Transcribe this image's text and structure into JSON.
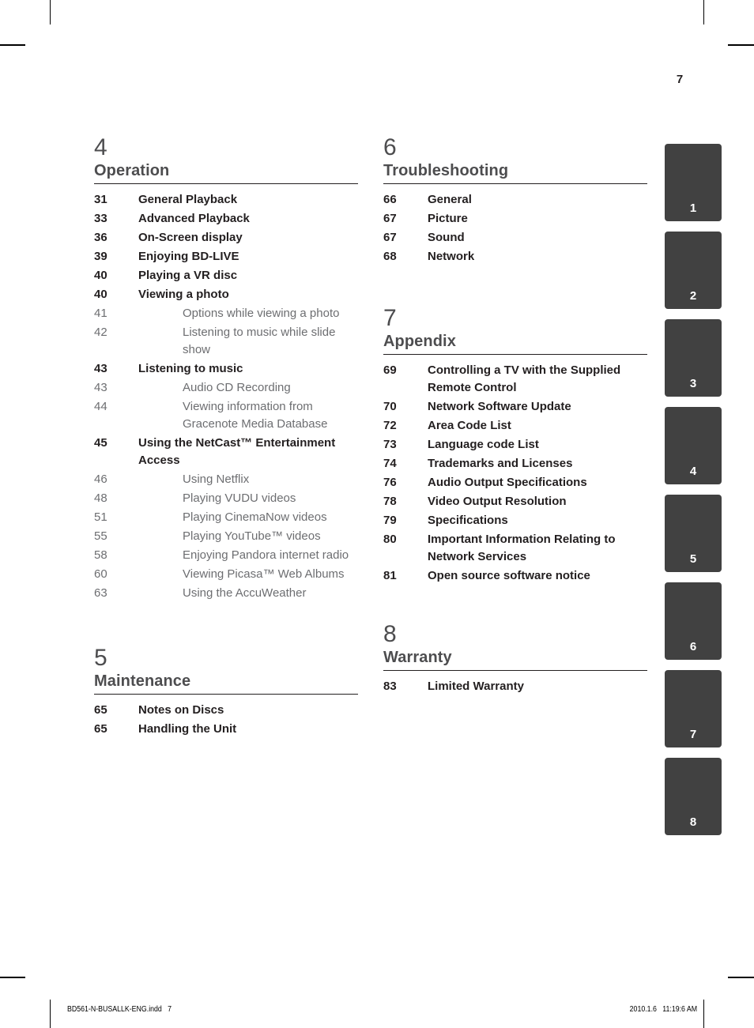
{
  "page": {
    "number": "7",
    "colors": {
      "heading": "#4d4d4f",
      "level1_text": "#231f20",
      "level2_text": "#6d6e71",
      "tab_background": "#414141",
      "tab_text": "#ffffff",
      "rule": "#231f20"
    }
  },
  "columns": {
    "left": [
      {
        "number": "4",
        "title": "Operation",
        "entries": [
          {
            "page": "31",
            "label": "General Playback",
            "level": 1
          },
          {
            "page": "33",
            "label": "Advanced Playback",
            "level": 1
          },
          {
            "page": "36",
            "label": "On-Screen display",
            "level": 1
          },
          {
            "page": "39",
            "label": "Enjoying BD-LIVE",
            "level": 1
          },
          {
            "page": "40",
            "label": "Playing a VR disc",
            "level": 1
          },
          {
            "page": "40",
            "label": "Viewing a photo",
            "level": 1
          },
          {
            "page": "41",
            "label": "Options while viewing a photo",
            "level": 2
          },
          {
            "page": "42",
            "label": "Listening to music while slide show",
            "level": 2
          },
          {
            "page": "43",
            "label": "Listening to music",
            "level": 1
          },
          {
            "page": "43",
            "label": "Audio CD Recording",
            "level": 2
          },
          {
            "page": "44",
            "label": "Viewing information from Gracenote Media Database",
            "level": 2
          },
          {
            "page": "45",
            "label": "Using the NetCast™ Entertainment Access",
            "level": 1
          },
          {
            "page": "46",
            "label": "Using Netflix",
            "level": 2
          },
          {
            "page": "48",
            "label": "Playing VUDU videos",
            "level": 2
          },
          {
            "page": "51",
            "label": "Playing CinemaNow videos",
            "level": 2
          },
          {
            "page": "55",
            "label": "Playing YouTube™ videos",
            "level": 2
          },
          {
            "page": "58",
            "label": "Enjoying Pandora internet radio",
            "level": 2
          },
          {
            "page": "60",
            "label": "Viewing Picasa™ Web Albums",
            "level": 2
          },
          {
            "page": "63",
            "label": "Using the AccuWeather",
            "level": 2
          }
        ]
      },
      {
        "number": "5",
        "title": "Maintenance",
        "entries": [
          {
            "page": "65",
            "label": "Notes on Discs",
            "level": 1
          },
          {
            "page": "65",
            "label": "Handling the Unit",
            "level": 1
          }
        ]
      }
    ],
    "right": [
      {
        "number": "6",
        "title": "Troubleshooting",
        "entries": [
          {
            "page": "66",
            "label": "General",
            "level": 1
          },
          {
            "page": "67",
            "label": "Picture",
            "level": 1
          },
          {
            "page": "67",
            "label": "Sound",
            "level": 1
          },
          {
            "page": "68",
            "label": "Network",
            "level": 1
          }
        ]
      },
      {
        "number": "7",
        "title": "Appendix",
        "entries": [
          {
            "page": "69",
            "label": "Controlling a TV with the Supplied Remote Control",
            "level": 1
          },
          {
            "page": "70",
            "label": "Network Software Update",
            "level": 1
          },
          {
            "page": "72",
            "label": "Area Code List",
            "level": 1
          },
          {
            "page": "73",
            "label": "Language code List",
            "level": 1
          },
          {
            "page": "74",
            "label": "Trademarks and Licenses",
            "level": 1
          },
          {
            "page": "76",
            "label": "Audio Output Specifications",
            "level": 1
          },
          {
            "page": "78",
            "label": "Video Output Resolution",
            "level": 1
          },
          {
            "page": "79",
            "label": "Specifications",
            "level": 1
          },
          {
            "page": "80",
            "label": "Important Information Relating to Network Services",
            "level": 1
          },
          {
            "page": "81",
            "label": "Open source software notice",
            "level": 1
          }
        ]
      },
      {
        "number": "8",
        "title": "Warranty",
        "entries": [
          {
            "page": "83",
            "label": "Limited Warranty",
            "level": 1
          }
        ]
      }
    ]
  },
  "side_tabs": [
    {
      "label": "1"
    },
    {
      "label": "2"
    },
    {
      "label": "3"
    },
    {
      "label": "4"
    },
    {
      "label": "5"
    },
    {
      "label": "6"
    },
    {
      "label": "7"
    },
    {
      "label": "8"
    }
  ],
  "footer": {
    "file": "BD561-N-BUSALLK-ENG.indd   7",
    "timestamp": "2010.1.6   11:19:6 AM"
  }
}
